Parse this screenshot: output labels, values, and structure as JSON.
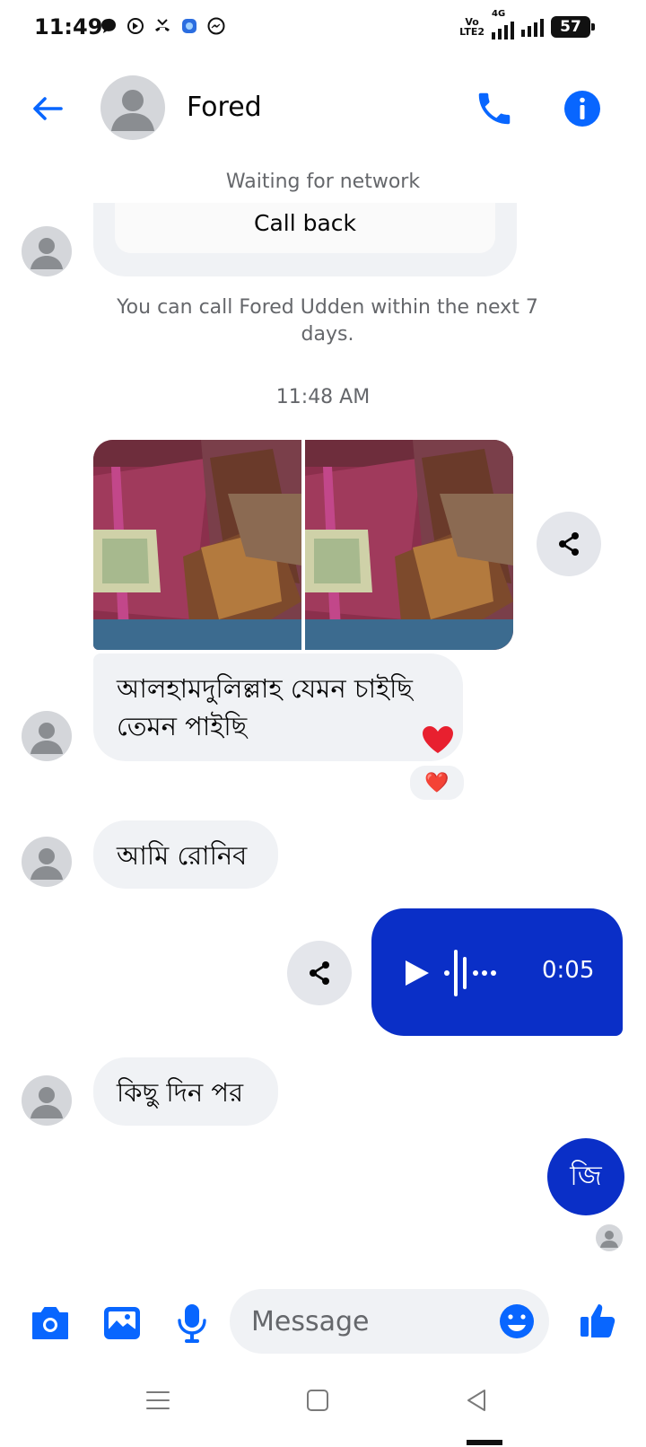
{
  "status_bar": {
    "time": "11:49",
    "network_top": "Vo",
    "network_bottom": "LTE2",
    "network_type": "4G",
    "battery": "57"
  },
  "header": {
    "contact_name": "Fored",
    "back_icon": "arrow-left-icon",
    "call_icon": "phone-icon",
    "info_icon": "info-icon"
  },
  "network_status": "Waiting for network",
  "call_card": {
    "button_label": "Call back",
    "note": "You can call Fored Udden within the next 7 days."
  },
  "timestamp": "11:48 AM",
  "messages": {
    "msg1": "আলহামদুলিল্লাহ যেমন চাইছি তেমন পাইছি",
    "msg1_reaction": "❤️",
    "msg2": "আমি রোনিব",
    "voice_duration": "0:05",
    "msg3": "কিছু দিন পর",
    "msg_out": "জি"
  },
  "composer": {
    "placeholder": "Message"
  },
  "colors": {
    "accent": "#0866ff",
    "outgoing": "#0a2fc7",
    "incoming": "#f0f2f5"
  }
}
